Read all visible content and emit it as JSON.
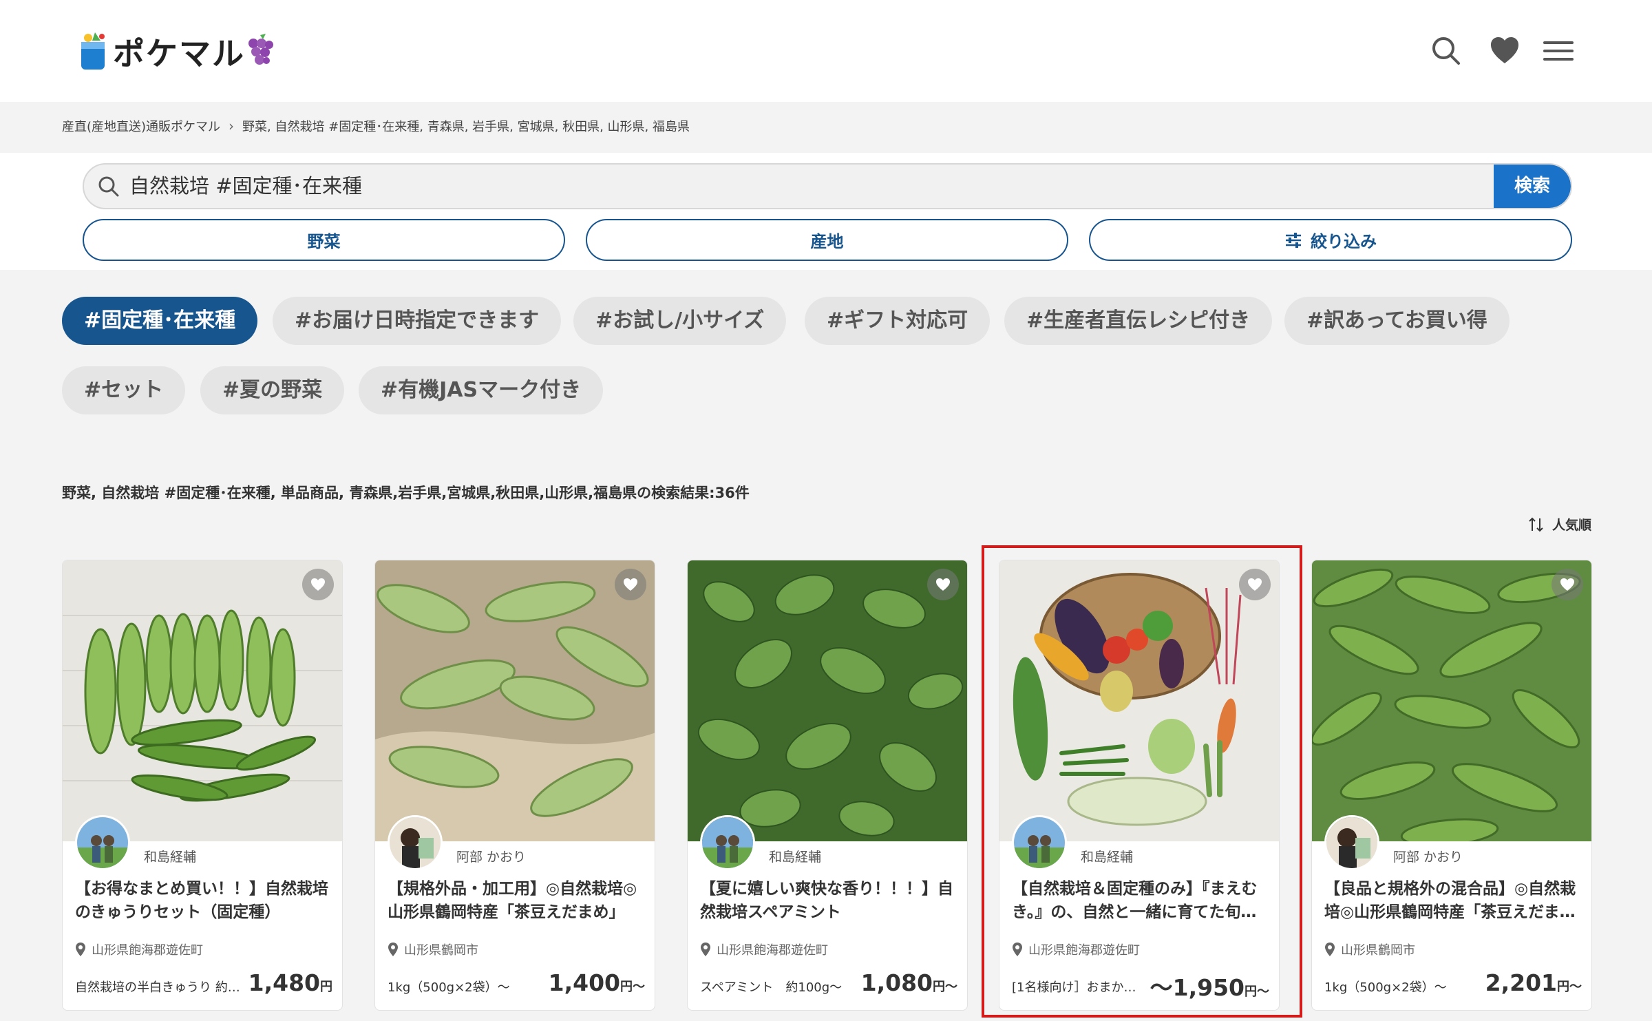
{
  "header": {
    "logo_text": "ポケマル",
    "icons": [
      "search-icon",
      "heart-icon",
      "menu-icon"
    ]
  },
  "breadcrumb": {
    "home": "産直(産地直送)通販ポケマル",
    "current": "野菜, 自然栽培 #固定種･在来種, 青森県, 岩手県, 宮城県, 秋田県, 山形県, 福島県"
  },
  "search": {
    "query": "自然栽培 #固定種･在来種",
    "button": "検索"
  },
  "filters": {
    "category": "野菜",
    "origin": "産地",
    "refine": "絞り込み"
  },
  "tags": [
    "#固定種･在来種",
    "#お届け日時指定できます",
    "#お試し/小サイズ",
    "#ギフト対応可",
    "#生産者直伝レシピ付き",
    "#訳あってお買い得",
    "#セット",
    "#夏の野菜",
    "#有機JASマーク付き"
  ],
  "result": {
    "text": "野菜, 自然栽培 #固定種･在来種, 単品商品, 青森県,岩手県,宮城県,秋田県,山形県,福島県の検索結果:36件",
    "sort": "人気順"
  },
  "products": [
    {
      "seller": "和島経輔",
      "title": "【お得なまとめ買い！！】自然栽培のきゅうりセット（固定種）",
      "location": "山形県飽海郡遊佐町",
      "variant": "自然栽培の半白きゅうり 約…",
      "price": "1,480",
      "unit": "円"
    },
    {
      "seller": "阿部 かおり",
      "title": "【規格外品・加工用】◎自然栽培◎山形県鶴岡特産「茶豆えだまめ」",
      "location": "山形県鶴岡市",
      "variant": "1kg（500g×2袋）～",
      "price": "1,400",
      "unit": "円～"
    },
    {
      "seller": "和島経輔",
      "title": "【夏に嬉しい爽快な香り！！！】自然栽培スペアミント",
      "location": "山形県飽海郡遊佐町",
      "variant": "スペアミント　約100g～",
      "price": "1,080",
      "unit": "円～"
    },
    {
      "seller": "和島経輔",
      "title": "【自然栽培＆固定種のみ】『まえむき。』の、自然と一緒に育てた旬…",
      "location": "山形県飽海郡遊佐町",
      "variant": "[1名様向け］おまか…",
      "price": "～1,950",
      "unit": "円～"
    },
    {
      "seller": "阿部 かおり",
      "title": "【良品と規格外の混合品】◎自然栽培◎山形県鶴岡特産「茶豆えだま…",
      "location": "山形県鶴岡市",
      "variant": "1kg（500g×2袋）～",
      "price": "2,201",
      "unit": "円～"
    }
  ]
}
